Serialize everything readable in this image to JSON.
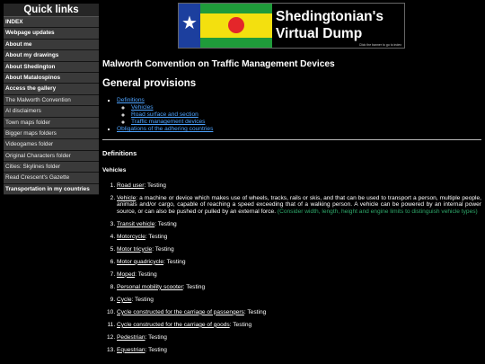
{
  "sidebar": {
    "title": "Quick links",
    "items": [
      {
        "label": "INDEX",
        "bold": true
      },
      {
        "label": "Webpage updates",
        "bold": true
      },
      {
        "label": "About me",
        "bold": true
      },
      {
        "label": "About my drawings",
        "bold": true
      },
      {
        "label": "About Shedington",
        "bold": true
      },
      {
        "label": "About Matalospinos",
        "bold": true
      },
      {
        "label": "Access the gallery",
        "bold": true
      },
      {
        "label": "The Malworth Convention",
        "bold": false
      },
      {
        "label": "AI disclaimers",
        "bold": false
      },
      {
        "label": "Town maps folder",
        "bold": false
      },
      {
        "label": "Bigger maps folders",
        "bold": false
      },
      {
        "label": "Videogames folder",
        "bold": false
      },
      {
        "label": "Original Characters folder",
        "bold": false
      },
      {
        "label": "Cities: Skylines folder",
        "bold": false
      },
      {
        "label": "Read Crescent's Gazette",
        "bold": false
      },
      {
        "label": "Transportation in my countries",
        "bold": true
      }
    ]
  },
  "banner": {
    "title_line1": "Shedingtonian's",
    "title_line2": "Virtual Dump",
    "small_text": "Click the banner to go to index",
    "colors": {
      "blue": "#1c3f9e",
      "green": "#1f9b3a",
      "yellow": "#f3e00f",
      "red": "#e4262a"
    }
  },
  "main": {
    "page_title": "Malworth Convention on Traffic Management Devices",
    "section_title": "General provisions",
    "toc": {
      "definitions": "Definitions",
      "sub": [
        "Vehicles",
        "Road surface and section",
        "Traffic management devices"
      ],
      "obligations": "Obligations of the adhering countries"
    },
    "definitions_heading": "Definitions",
    "vehicles_heading": "Vehicles",
    "definitions": [
      {
        "term": "Road user",
        "text": ": Testing"
      },
      {
        "term": "Vehicle",
        "text": ": a machine or device which makes use of wheels, tracks, rails or skis, and that can be used to transport a person, multiple people, animals and/or cargo, capable of reaching a speed exceeding that of a walking person. A vehicle can be powered by an internal power source, or can also be pushed or pulled by an external force.",
        "note": " (Consider width, length, height and engine limits to distinguish vehicle types)"
      },
      {
        "term": "Transit vehicle",
        "text": ": Testing"
      },
      {
        "term": "Motorcycle",
        "text": ": Testing"
      },
      {
        "term": "Motor tricycle",
        "text": ": Testing"
      },
      {
        "term": "Motor quadricycle",
        "text": ": Testing"
      },
      {
        "term": "Moped",
        "text": ": Testing"
      },
      {
        "term": "Personal mobility scooter",
        "text": ": Testing"
      },
      {
        "term": "Cycle",
        "text": ": Testing"
      },
      {
        "term": "Cycle constructed for the carriage of passengers",
        "text": ": Testing"
      },
      {
        "term": "Cycle constructed for the carriage of goods",
        "text": ": Testing"
      },
      {
        "term": "Pedestrian",
        "text": ": Testing"
      },
      {
        "term": "Equestrian",
        "text": ": Testing"
      }
    ]
  }
}
